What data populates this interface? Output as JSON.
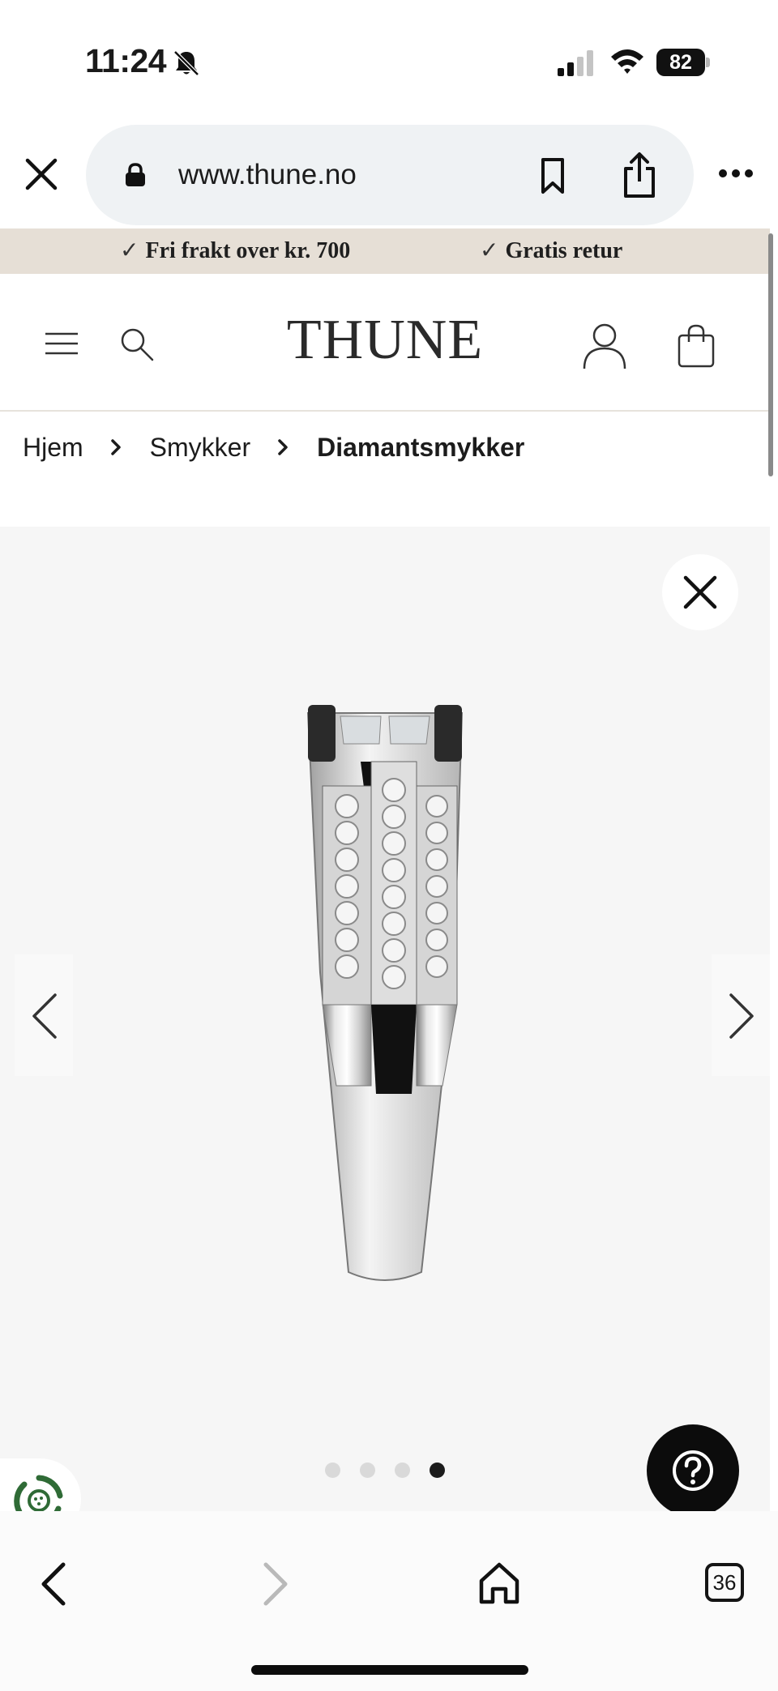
{
  "status_bar": {
    "time": "11:24",
    "battery": "82",
    "icons": [
      "bell-off-icon",
      "signal-icon",
      "wifi-icon",
      "battery-icon"
    ]
  },
  "browser": {
    "url": "www.thune.no",
    "icons": [
      "close-icon",
      "lock-icon",
      "bookmark-icon",
      "share-icon",
      "more-icon"
    ]
  },
  "promo": {
    "items": [
      {
        "check": "✓",
        "label": "Fri frakt over kr. 700"
      },
      {
        "check": "✓",
        "label": "Gratis retur"
      }
    ]
  },
  "header": {
    "logo": "THUNE",
    "icons": [
      "menu-icon",
      "search-icon",
      "account-icon",
      "shopping-bag-icon"
    ]
  },
  "breadcrumb": {
    "items": [
      "Hjem",
      "Smykker",
      "Diamantsmykker"
    ]
  },
  "gallery": {
    "image": "diamond-ring-side-view",
    "slide_count": 4,
    "active_slide": 4,
    "colors": {
      "background": "#f6f6f6",
      "active_dot": "#1c1c1c",
      "inactive_dot": "#d9d9d9"
    }
  },
  "toolbar": {
    "tab_count": "36",
    "icons": [
      "back-icon",
      "forward-icon",
      "home-icon",
      "tabs-icon"
    ]
  },
  "colors": {
    "promo_bg": "#e6dfd6",
    "help_button": "#0c0c0c",
    "eco_green": "#2f6b36"
  }
}
